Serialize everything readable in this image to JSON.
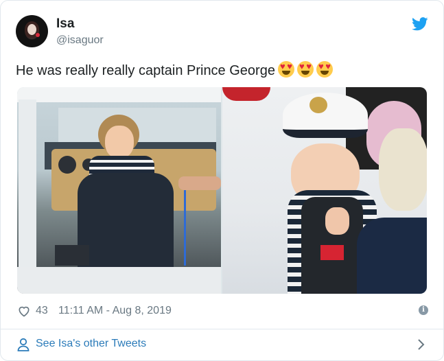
{
  "tweet": {
    "author_name": "Isa",
    "author_handle": "@isaguor",
    "text": "He was really really captain Prince George",
    "emoji": [
      "smiling-face-with-heart-eyes",
      "smiling-face-with-heart-eyes",
      "smiling-face-with-heart-eyes"
    ],
    "like_count": "43",
    "timestamp": "11:11 AM - Aug 8, 2019",
    "see_more_label": "See Isa's other Tweets"
  },
  "photos": [
    {
      "name": "photo-boy-at-boat-helm"
    },
    {
      "name": "photo-boy-in-captain-hat"
    }
  ],
  "colors": {
    "twitter_blue": "#1da1f2",
    "link_blue": "#2b7bb9",
    "meta_gray": "#697882",
    "border": "#e1e8ed"
  }
}
